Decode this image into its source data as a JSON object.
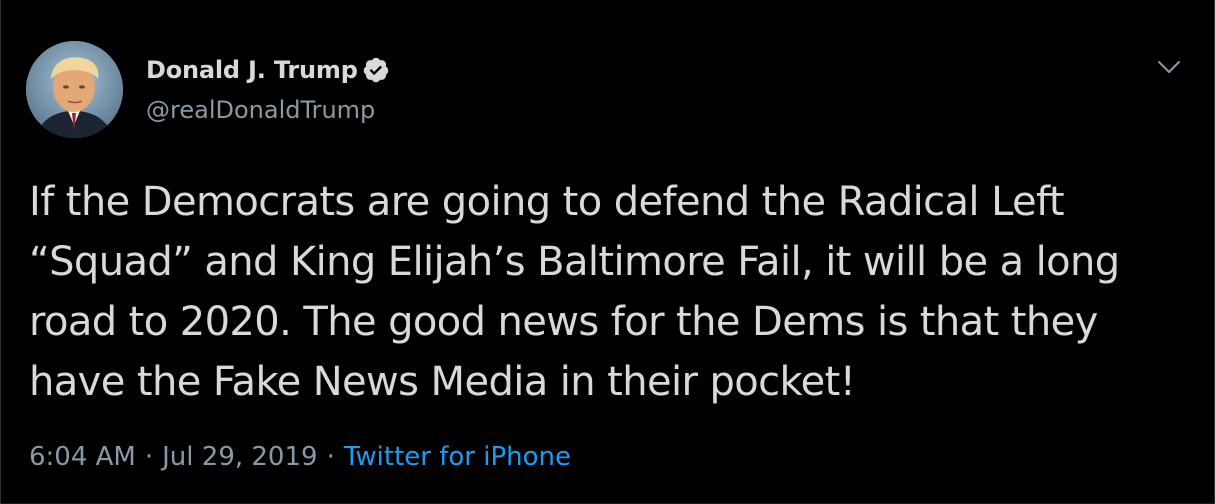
{
  "tweet": {
    "author": {
      "display_name": "Donald J. Trump",
      "handle": "@realDonaldTrump",
      "verified": true,
      "avatar_icon": "profile-photo"
    },
    "menu_icon": "chevron-down-icon",
    "text_lines": [
      "If the Democrats are going to defend the Radical Left",
      "“Squad” and King Elijah’s Baltimore Fail, it will be a long",
      "road to 2020. The good news for the Dems is that they",
      "have the Fake News Media in their pocket!"
    ],
    "meta": {
      "time": "6:04 AM",
      "separator": "·",
      "date": "Jul 29, 2019",
      "source": "Twitter for iPhone"
    }
  },
  "colors": {
    "background": "#000000",
    "text": "#d9d9d9",
    "secondary_text": "#8b98a5",
    "link": "#1d9bf0"
  }
}
